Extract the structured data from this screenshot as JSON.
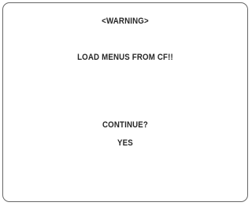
{
  "osd": {
    "heading": "<WARNING>",
    "message": "LOAD MENUS FROM CF!!",
    "prompt": "CONTINUE?",
    "option": "YES"
  }
}
